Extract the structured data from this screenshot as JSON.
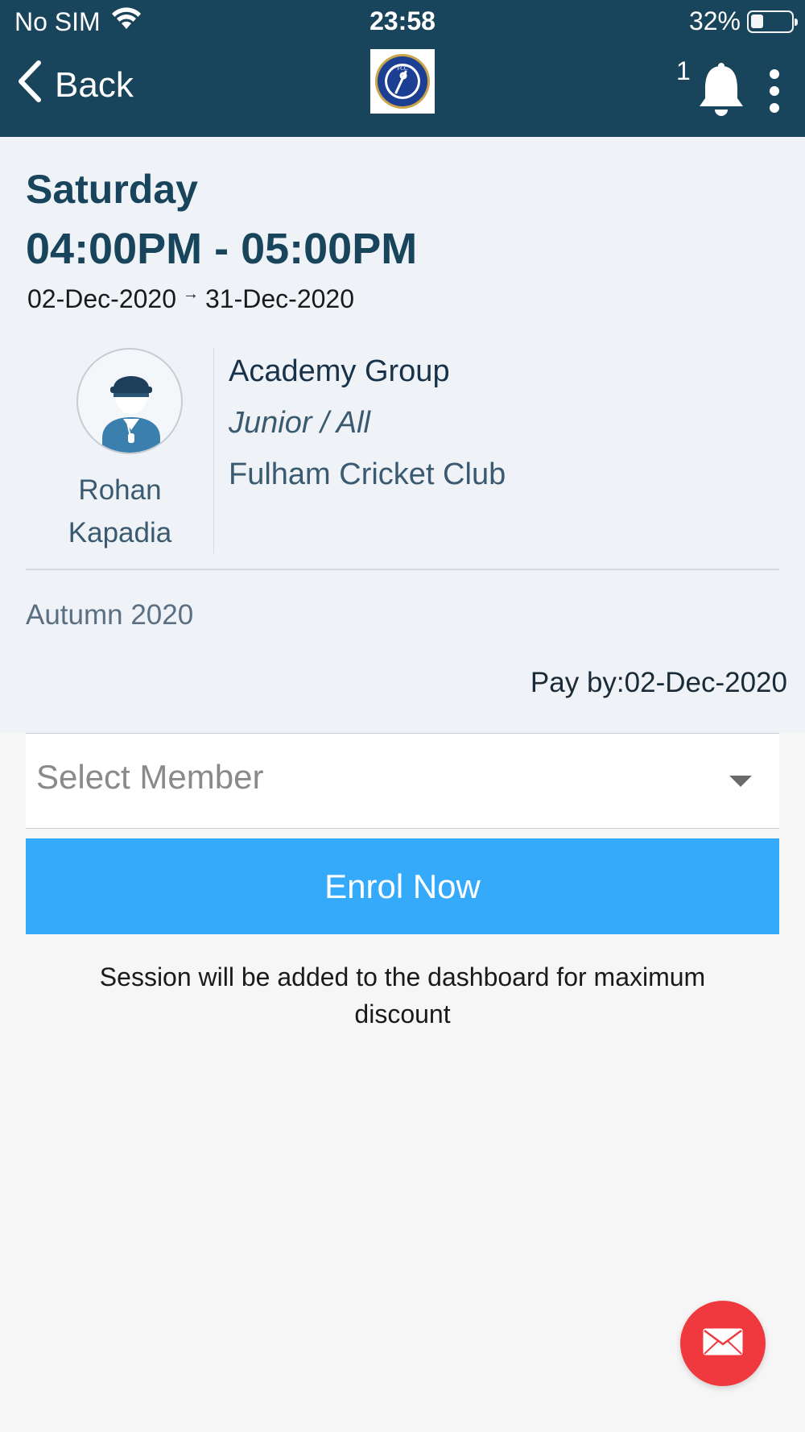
{
  "status_bar": {
    "carrier": "No SIM",
    "time": "23:58",
    "battery": "32%",
    "battery_level": 0.32
  },
  "header": {
    "back_label": "Back",
    "logo_text": "FCC",
    "notification_count": "1"
  },
  "session": {
    "day": "Saturday",
    "time_range": "04:00PM - 05:00PM",
    "start_date": "02-Dec-2020",
    "end_date": "31-Dec-2020",
    "coach_name": "Rohan Kapadia",
    "group_name": "Academy Group",
    "group_level": "Junior / All",
    "club": "Fulham Cricket Club",
    "term": "Autumn 2020",
    "pay_by": "Pay by:02-Dec-2020"
  },
  "enrol": {
    "select_placeholder": "Select Member",
    "button_label": "Enrol Now",
    "note": "Session will be added to the dashboard for maximum discount"
  },
  "colors": {
    "header_bg": "#18445c",
    "panel_bg": "#eff3f8",
    "primary_button": "#35aafb",
    "fab": "#f0393e"
  }
}
